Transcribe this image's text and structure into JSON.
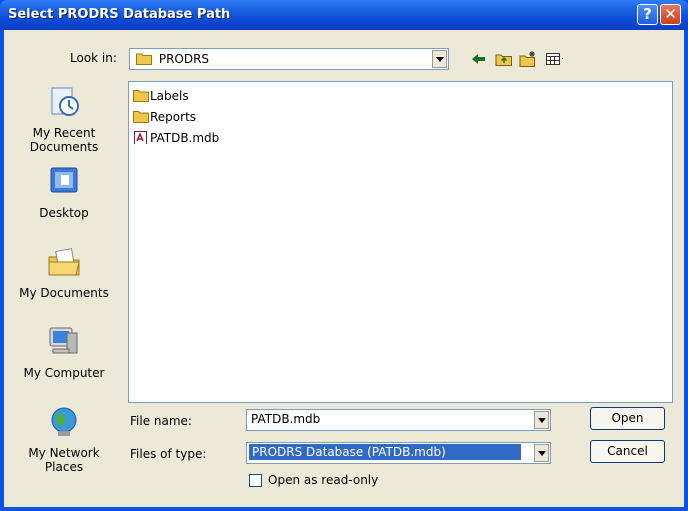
{
  "window": {
    "title": "Select PRODRS Database Path"
  },
  "titlebar": {
    "help_icon": "?",
    "close_icon": "✕"
  },
  "lookin": {
    "label": "Look in:",
    "value": "PRODRS"
  },
  "toolbar": {
    "icons": [
      "back-arrow-icon",
      "up-folder-icon",
      "new-folder-icon",
      "view-menu-icon"
    ]
  },
  "places": [
    {
      "label_lines": [
        "My Recent",
        "Documents"
      ],
      "icon": "recent-documents-icon"
    },
    {
      "label_lines": [
        "Desktop"
      ],
      "icon": "desktop-icon"
    },
    {
      "label_lines": [
        "My Documents"
      ],
      "icon": "my-documents-icon"
    },
    {
      "label_lines": [
        "My Computer"
      ],
      "icon": "my-computer-icon"
    },
    {
      "label_lines": [
        "My Network",
        "Places"
      ],
      "icon": "network-places-icon"
    }
  ],
  "files": [
    {
      "name": "Labels",
      "type": "folder"
    },
    {
      "name": "Reports",
      "type": "folder"
    },
    {
      "name": "PATDB.mdb",
      "type": "access-db"
    }
  ],
  "filename": {
    "label": "File name:",
    "value": "PATDB.mdb"
  },
  "filetype": {
    "label": "Files of type:",
    "value": "PRODRS Database (PATDB.mdb)"
  },
  "readonly": {
    "label": "Open as read-only",
    "checked": false
  },
  "buttons": {
    "open": "Open",
    "cancel": "Cancel"
  },
  "colors": {
    "titlebar": "#0a3fc0",
    "dialog_bg": "#ece9d8",
    "selection": "#316ac5"
  }
}
